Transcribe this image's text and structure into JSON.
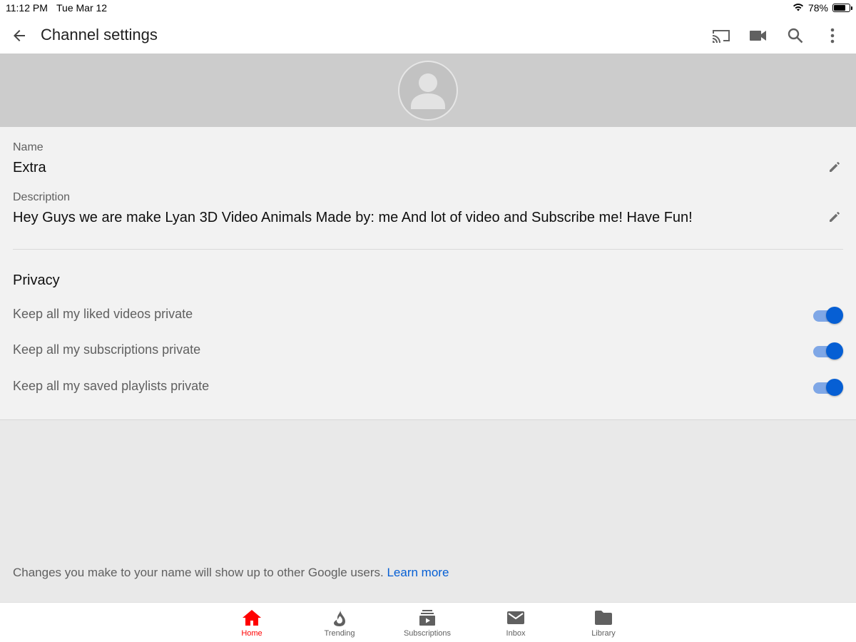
{
  "status_bar": {
    "time": "11:12 PM",
    "date": "Tue Mar 12",
    "battery": "78%",
    "battery_level": 0.78
  },
  "app_bar": {
    "title": "Channel settings",
    "icons": [
      "back-arrow-icon",
      "cast-icon",
      "video-camera-icon",
      "search-icon",
      "more-vert-icon"
    ]
  },
  "channel": {
    "name_label": "Name",
    "name_value": "Extra",
    "description_label": "Description",
    "description_value": "Hey Guys we are make Lyan 3D Video Animals Made by: me And lot of video and Subscribe me! Have Fun!"
  },
  "privacy": {
    "title": "Privacy",
    "toggles": [
      {
        "label": "Keep all my liked videos private",
        "on": true
      },
      {
        "label": "Keep all my subscriptions private",
        "on": true
      },
      {
        "label": "Keep all my saved playlists private",
        "on": true
      }
    ]
  },
  "footer": {
    "note": "Changes you make to your name will show up to other Google users.",
    "link": "Learn more"
  },
  "nav": {
    "items": [
      {
        "label": "Home",
        "icon": "home-icon",
        "active": true
      },
      {
        "label": "Trending",
        "icon": "flame-icon",
        "active": false
      },
      {
        "label": "Subscriptions",
        "icon": "subscriptions-icon",
        "active": false
      },
      {
        "label": "Inbox",
        "icon": "mail-icon",
        "active": false
      },
      {
        "label": "Library",
        "icon": "folder-icon",
        "active": false
      }
    ]
  },
  "colors": {
    "accent": "#065fd4",
    "toggle_track": "#7fa7e6",
    "active_nav": "#ff0000",
    "banner": "#cccccc"
  }
}
